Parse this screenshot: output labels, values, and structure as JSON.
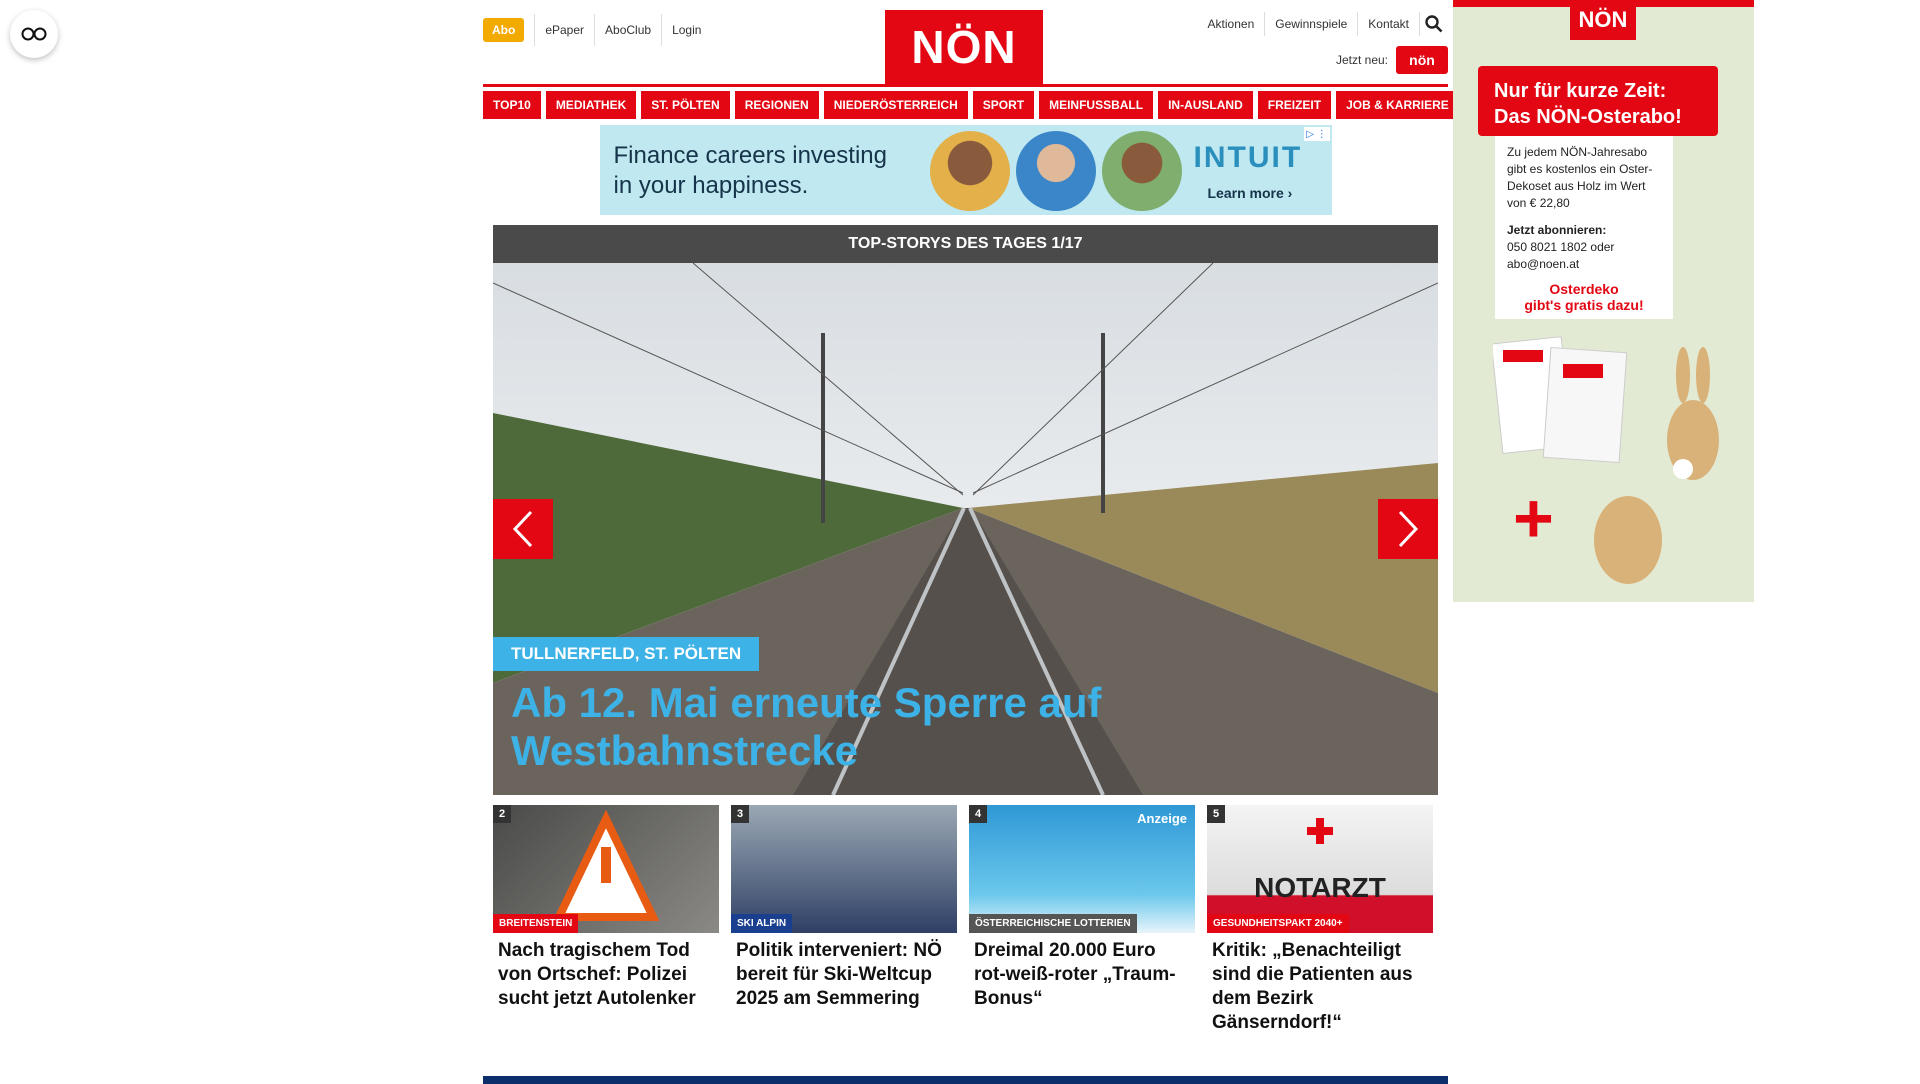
{
  "header": {
    "left_links": [
      "Abo",
      "ePaper",
      "AboClub",
      "Login"
    ],
    "logo": "NÖN",
    "right_links": [
      "Aktionen",
      "Gewinnspiele",
      "Kontakt"
    ],
    "jetzt_neu": "Jetzt neu:",
    "jetzt_badge": "nön"
  },
  "nav": [
    "TOP10",
    "MEDIATHEK",
    "ST. PÖLTEN",
    "REGIONEN",
    "NIEDERÖSTERREICH",
    "SPORT",
    "MEINFUSSBALL",
    "IN-AUSLAND",
    "FREIZEIT",
    "JOB & KARRIERE"
  ],
  "ad_banner": {
    "line1": "Finance careers investing",
    "line2": "in your happiness.",
    "brand": "INTUIT",
    "cta": "Learn more ›"
  },
  "slider": {
    "heading": "TOP-STORYS DES TAGES 1/17",
    "kicker": "TULLNERFELD, ST. PÖLTEN",
    "title": "Ab 12. Mai erneute Sperre auf Westbahnstrecke"
  },
  "teasers": [
    {
      "num": "2",
      "tag": "BREITENSTEIN",
      "headline": "Nach tragischem Tod von Ortschef: Polizei sucht jetzt Autolenker",
      "tag_color": "#e30613"
    },
    {
      "num": "3",
      "tag": "SKI ALPIN",
      "headline": "Politik interveniert: NÖ bereit für Ski-Weltcup 2025 am Semmering",
      "tag_color": "#1b3f8f"
    },
    {
      "num": "4",
      "tag": "ÖSTERREICHISCHE LOTTERIEN",
      "headline": "Dreimal 20.000 Euro rot-weiß-roter „Traum-Bonus“",
      "tag_color": "#555555",
      "label": "Anzeige"
    },
    {
      "num": "5",
      "tag": "GESUNDHEITSPAKT 2040+",
      "headline": "Kritik: „Benachteiligt sind die Patienten aus dem Bezirk Gänserndorf!“",
      "tag_color": "#e30613"
    }
  ],
  "side_ad": {
    "logo": "NÖN",
    "headline1": "Nur für kurze Zeit:",
    "headline2": "Das NÖN-Osterabo!",
    "body": "Zu jedem NÖN-Jahresabo gibt es kostenlos ein Oster-Dekoset aus Holz im Wert von € 22,80",
    "cta_title": "Jetzt abonnieren:",
    "cta_body": "050 8021 1802 oder abo@noen.at",
    "promo1": "Osterdeko",
    "promo2": "gibt's gratis dazu!"
  }
}
